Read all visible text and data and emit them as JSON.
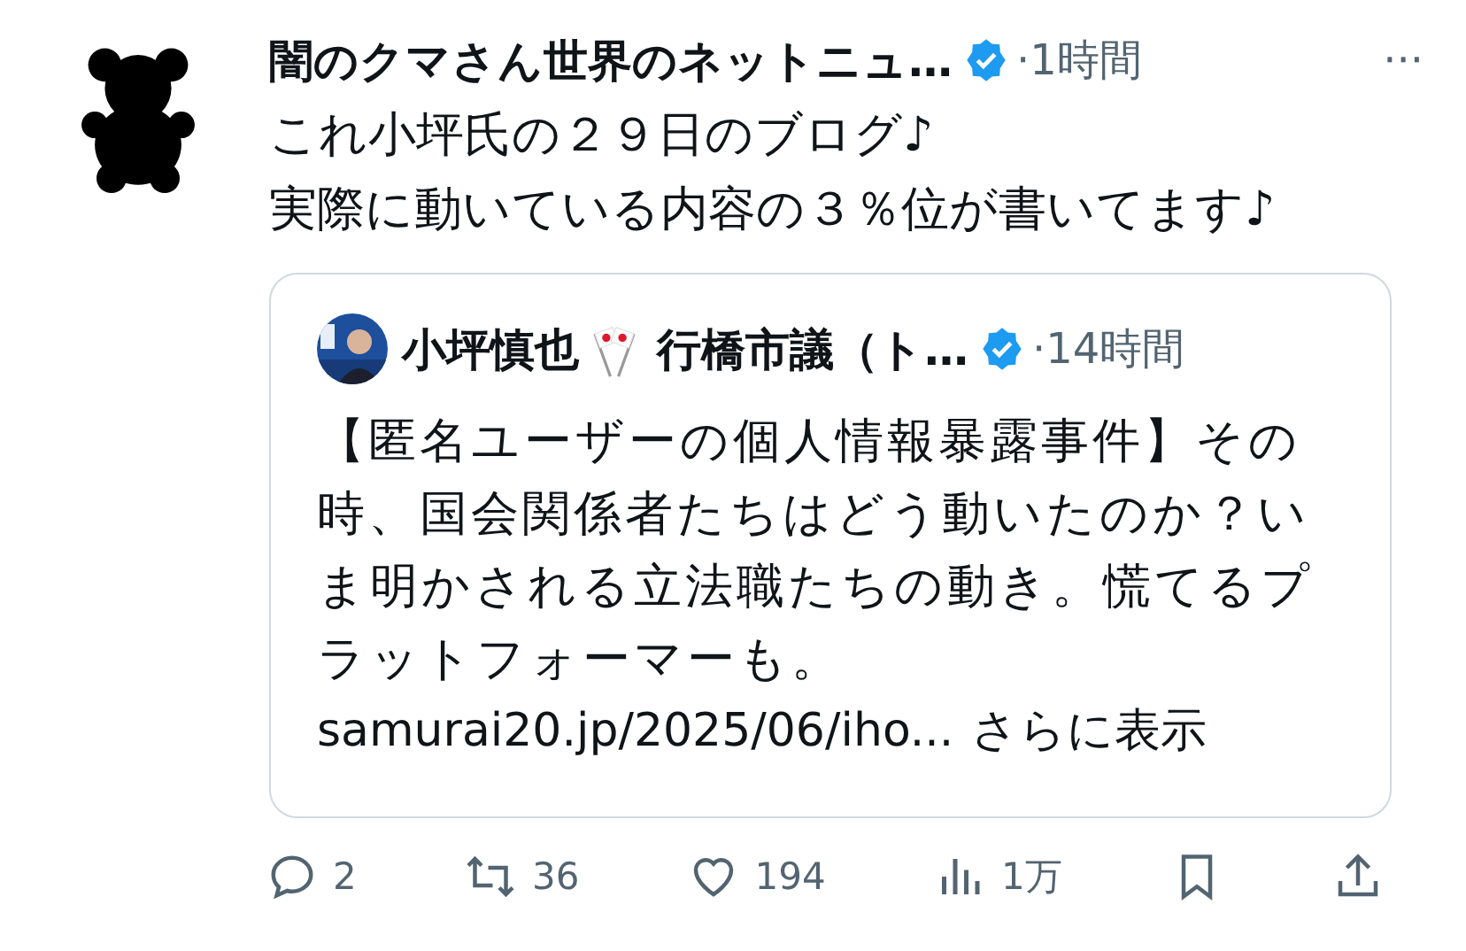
{
  "post": {
    "author": "闇のクマさん世界のネットニュ…",
    "verified": true,
    "time": "·1時間",
    "more": "···",
    "lines": [
      "これ小坪氏の２９日のブログ♪",
      "実際に動いている内容の３％位が書いてます♪"
    ],
    "quote": {
      "author": "小坪慎也",
      "author_suffix": "行橋市議（ト…",
      "verified": true,
      "time": "·14時間",
      "text": "【匿名ユーザーの個人情報暴露事件】その時、国会関係者たちはどう動いたのか？いま明かされる立法職たちの動き。慌てるプラットフォーマーも。",
      "link": "samurai20.jp/2025/06/iho...",
      "show_more": "さらに表示"
    },
    "actions": [
      {
        "kind": "reply",
        "count": "2"
      },
      {
        "kind": "repost",
        "count": "36"
      },
      {
        "kind": "like",
        "count": "194"
      },
      {
        "kind": "views",
        "count": "1万"
      },
      {
        "kind": "bookmark"
      },
      {
        "kind": "share"
      }
    ]
  }
}
